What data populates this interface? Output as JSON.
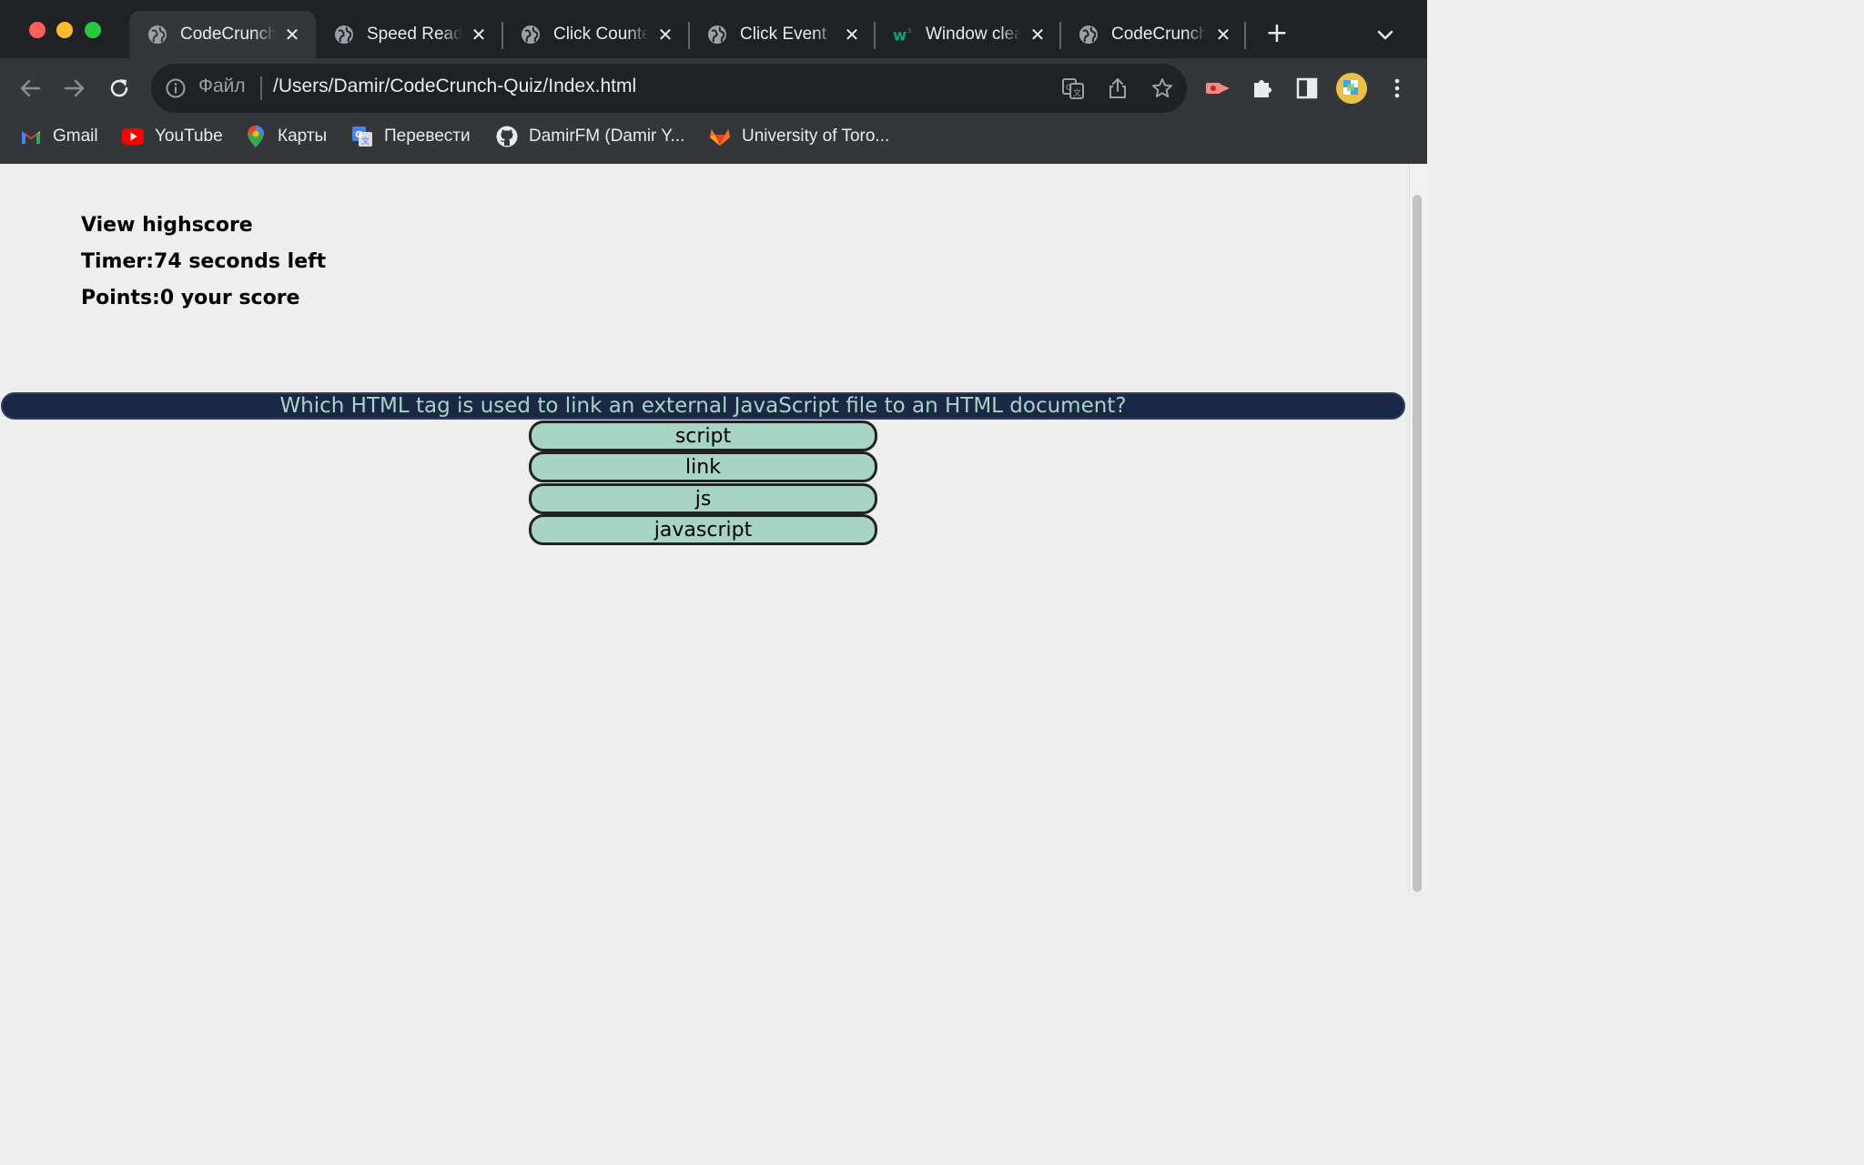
{
  "browser": {
    "tabs": [
      {
        "title": "CodeCrunch",
        "favicon": "globe-icon",
        "active": true
      },
      {
        "title": "Speed Reader",
        "favicon": "globe-icon",
        "active": false
      },
      {
        "title": "Click Counter",
        "favicon": "globe-icon",
        "active": false
      },
      {
        "title": "Click Event",
        "favicon": "globe-icon",
        "active": false
      },
      {
        "title": "Window clear",
        "favicon": "w3schools-icon",
        "active": false
      },
      {
        "title": "CodeCrunch",
        "favicon": "globe-icon",
        "active": false
      }
    ],
    "new_tab_symbol": "+",
    "address": {
      "scheme_label": "Файл",
      "url": "/Users/Damir/CodeCrunch-Quiz/Index.html"
    },
    "bookmarks": [
      {
        "label": "Gmail",
        "icon": "gmail-icon"
      },
      {
        "label": "YouTube",
        "icon": "youtube-icon"
      },
      {
        "label": "Карты",
        "icon": "maps-icon"
      },
      {
        "label": "Перевести",
        "icon": "translate-icon"
      },
      {
        "label": "DamirFM (Damir Y...",
        "icon": "github-icon"
      },
      {
        "label": "University of Toro...",
        "icon": "gitlab-icon"
      }
    ],
    "colors": {
      "frame": "#202124",
      "toolbar": "#35363a"
    }
  },
  "quiz": {
    "highscore_link": "View highscore",
    "timer_text": "Timer:74 seconds left",
    "points_text": "Points:0 your score",
    "question": "Which HTML tag is used to link an external JavaScript file to an HTML document?",
    "answers": [
      "script",
      "link",
      "js",
      "javascript"
    ],
    "colors": {
      "question_bg": "#1a2745",
      "answer_bg": "#a8d4c6",
      "question_text": "#a8d4c6"
    }
  }
}
